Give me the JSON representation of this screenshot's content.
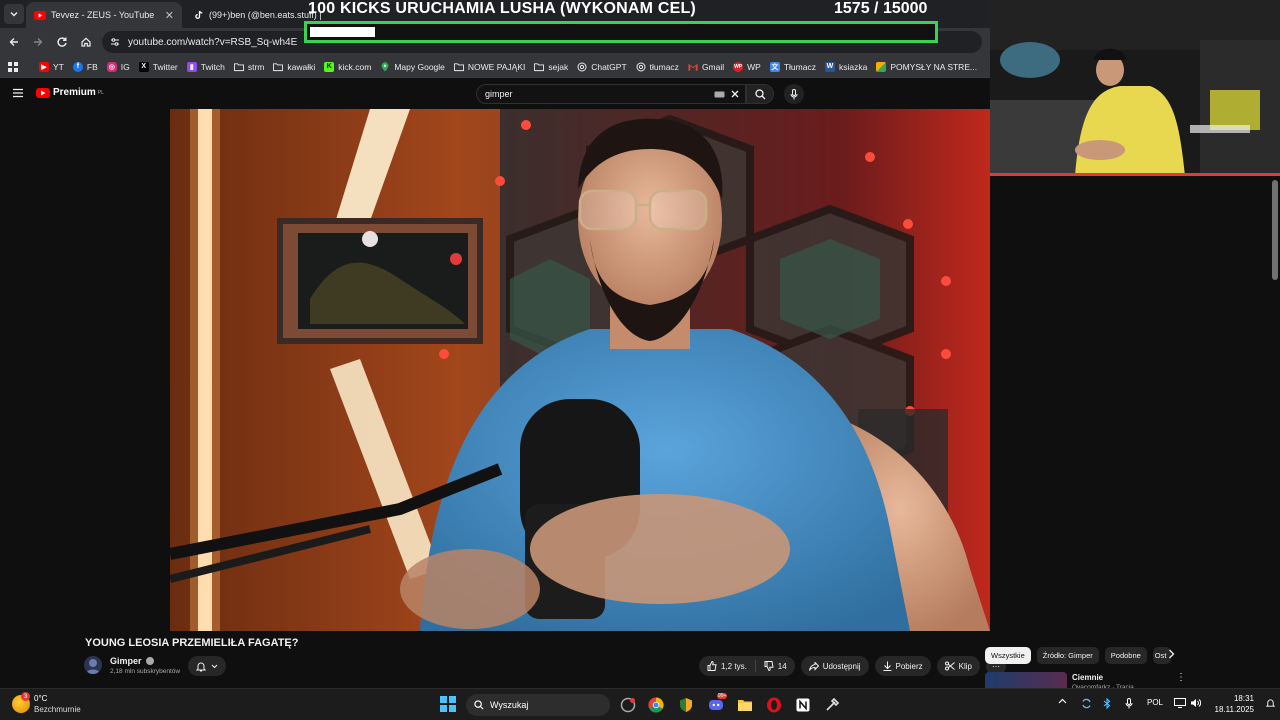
{
  "browser": {
    "tabs": [
      {
        "title": "Tevvez - ZEUS - YouTube",
        "active": true,
        "favicon": "youtube-icon"
      },
      {
        "title": "(99+)ben (@ben.eats.stuff) |",
        "active": false,
        "favicon": "tiktok-icon"
      }
    ],
    "url": "youtube.com/watch?v=RSB_Sq-wh4E",
    "bookmarks": [
      {
        "label": "YT",
        "icon": "youtube-icon",
        "color": "#ff0000"
      },
      {
        "label": "FB",
        "icon": "facebook-icon",
        "color": "#1877f2"
      },
      {
        "label": "IG",
        "icon": "instagram-icon",
        "color": "#d62976"
      },
      {
        "label": "Twitter",
        "icon": "x-icon",
        "color": "#000000"
      },
      {
        "label": "Twitch",
        "icon": "twitch-icon",
        "color": "#9146ff"
      },
      {
        "label": "strm",
        "icon": "folder-icon",
        "color": ""
      },
      {
        "label": "kawałki",
        "icon": "folder-icon",
        "color": ""
      },
      {
        "label": "kick.com",
        "icon": "kick-icon",
        "color": "#53fc18"
      },
      {
        "label": "Mapy Google",
        "icon": "maps-icon",
        "color": "#34a853"
      },
      {
        "label": "NOWE PAJĄKI",
        "icon": "folder-icon",
        "color": ""
      },
      {
        "label": "sejak",
        "icon": "folder-icon",
        "color": ""
      },
      {
        "label": "ChatGPT",
        "icon": "chatgpt-icon",
        "color": "#cccccc"
      },
      {
        "label": "tłumacz",
        "icon": "chatgpt-icon",
        "color": "#cccccc"
      },
      {
        "label": "Gmail",
        "icon": "gmail-icon",
        "color": "#ea4335"
      },
      {
        "label": "WP",
        "icon": "wp-icon",
        "color": "#e31e24"
      },
      {
        "label": "Tłumacz",
        "icon": "translate-icon",
        "color": "#4285f4"
      },
      {
        "label": "ksiazka",
        "icon": "word-icon",
        "color": "#2b579a"
      },
      {
        "label": "POMYSŁY NA STRE...",
        "icon": "gallery-icon",
        "color": "#f9ab00"
      }
    ]
  },
  "youtube": {
    "logo_text": "Premium",
    "logo_region": "PL",
    "search_value": "gimper",
    "video": {
      "title": "YOUNG LEOSIA PRZEMIELIŁA FAGATĘ?",
      "channel": "Gimper",
      "subscribers": "2,18 mln subskrybentów",
      "likes": "1,2 tys.",
      "dislikes": "14",
      "share_label": "Udostępnij",
      "download_label": "Pobierz",
      "clip_label": "Klip"
    },
    "chips": [
      "Wszystkie",
      "Źródło: Gimper",
      "Podobne",
      "Ost"
    ],
    "recommendation": {
      "title": "Ciemnie",
      "meta": "Ovacomfarkz · Tracia"
    }
  },
  "overlay": {
    "goal_title": "100 KICKS URUCHAMIA LUSHA (WYKONAM CEL)",
    "goal_current": "1575",
    "goal_target": "/ 15000",
    "goal_fraction": 0.105,
    "accent_color": "#39d353",
    "webcam_border_color": "#e53935"
  },
  "taskbar": {
    "weather_badge": "3",
    "temperature": "0°C",
    "weather_desc": "Bezchmurnie",
    "search_placeholder": "Wyszukaj",
    "language": "POL",
    "time": "18:31",
    "date": "18.11.2025",
    "discord_badge": "99+"
  }
}
